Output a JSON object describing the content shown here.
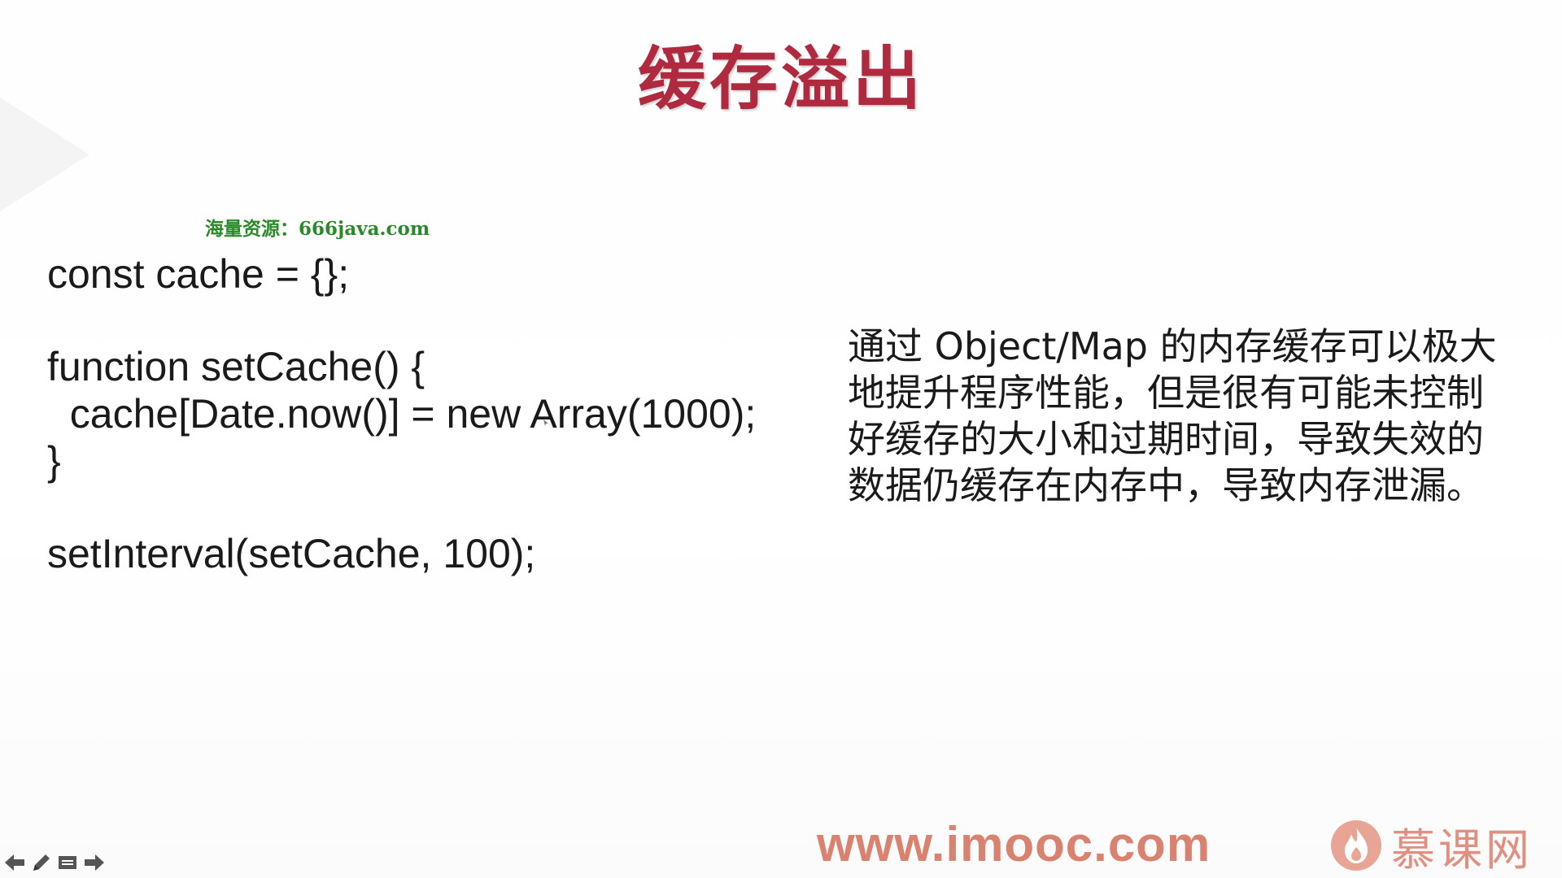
{
  "slide": {
    "title": "缓存溢出",
    "watermark": "海量资源：666java.com",
    "code_lines": [
      "const cache = {};",
      "",
      "function setCache() {",
      "  cache[Date.now()] = new Array(1000);",
      "}",
      "",
      "setInterval(setCache, 100);"
    ],
    "description_lines": [
      "通过 Object/Map 的内存缓存可以极大",
      "地提升程序性能，但是很有可能未控制",
      "好缓存的大小和过期时间，导致失效的",
      "数据仍缓存在内存中，导致内存泄漏。"
    ]
  },
  "footer": {
    "url": "www.imooc.com",
    "brand": "慕课网"
  },
  "controls": {
    "icons": [
      "arrow-left-icon",
      "pen-icon",
      "slide-menu-icon",
      "arrow-right-icon"
    ]
  },
  "colors": {
    "title": "#b02a3f",
    "watermark": "#2a8a2a",
    "footer_url": "#d9826f",
    "brand": "#e08f80"
  }
}
